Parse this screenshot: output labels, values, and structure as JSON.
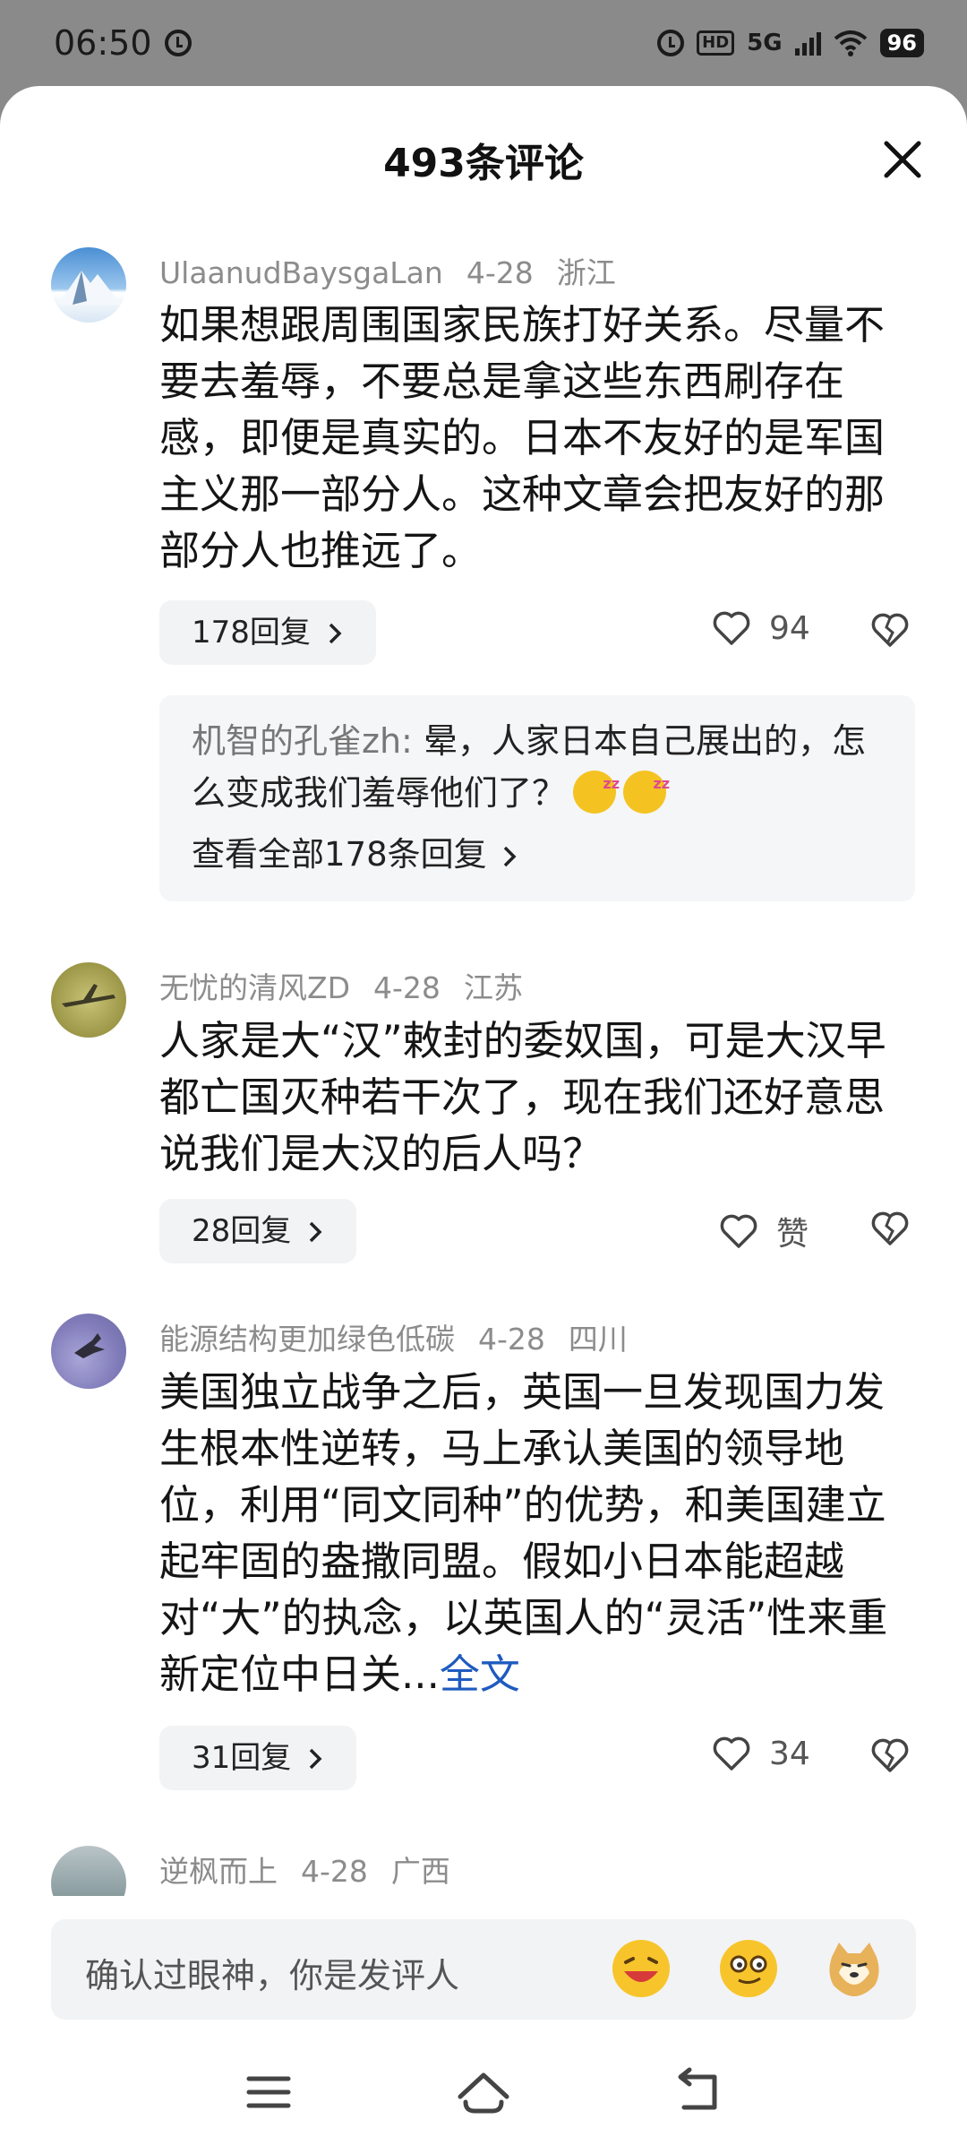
{
  "status_bar": {
    "time": "06:50",
    "hd": "HD",
    "network": "5G",
    "battery": "96"
  },
  "sheet": {
    "title": "493条评论"
  },
  "comments": [
    {
      "author": "UlaanudBaysgaLan",
      "date": "4-28",
      "location": "浙江",
      "text": "如果想跟周围国家民族打好关系。尽量不要去羞辱，不要总是拿这些东西刷存在感，即便是真实的。日本不友好的是军国主义那一部分人。这种文章会把友好的那部分人也推远了。",
      "replies": "178回复",
      "likes": "94",
      "sub": {
        "author": "机智的孔雀zh:",
        "text": "晕，人家日本自己展出的，怎么变成我们羞辱他们了？",
        "view_all": "查看全部178条回复"
      }
    },
    {
      "author": "无忧的清风ZD",
      "date": "4-28",
      "location": "江苏",
      "text": "人家是大“汉”敕封的委奴国，可是大汉早都亡国灭种若干次了，现在我们还好意思说我们是大汉的后人吗？",
      "replies": "28回复",
      "likes": "赞"
    },
    {
      "author": "能源结构更加绿色低碳",
      "date": "4-28",
      "location": "四川",
      "text": "美国独立战争之后，英国一旦发现国力发生根本性逆转，马上承认美国的领导地位，利用“同文同种”的优势，和美国建立起牢固的盎撒同盟。假如小日本能超越对“大”的执念，以英国人的“灵活”性来重新定位中日关...",
      "more": "全文",
      "replies": "31回复",
      "likes": "34"
    },
    {
      "author": "逆枫而上",
      "date": "4-28",
      "location": "广西"
    }
  ],
  "input": {
    "placeholder": "确认过眼神，你是发评人"
  },
  "colors": {
    "link": "#1e5bbf",
    "meta": "#8c8c8c",
    "pill_bg": "#f2f3f5"
  },
  "icons": [
    "alarm-icon",
    "signal-icon",
    "wifi-icon",
    "close-icon",
    "heart-icon",
    "broken-heart-icon",
    "chevron-right-icon",
    "menu-icon",
    "home-icon",
    "back-icon"
  ]
}
